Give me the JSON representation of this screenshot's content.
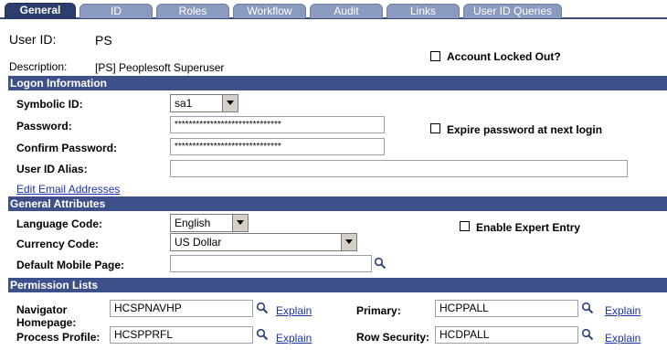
{
  "tabs": [
    "General",
    "ID",
    "Roles",
    "Workflow",
    "Audit",
    "Links",
    "User ID Queries"
  ],
  "header": {
    "user_id_label": "User ID:",
    "user_id_value": "PS",
    "description_label": "Description:",
    "description_value": "[PS] Peoplesoft Superuser",
    "account_locked_label": "Account Locked Out?"
  },
  "logon": {
    "section_title": "Logon Information",
    "symbolic_id_label": "Symbolic ID:",
    "symbolic_id_value": "sa1",
    "password_label": "Password:",
    "password_value": "******************************",
    "confirm_password_label": "Confirm Password:",
    "confirm_password_value": "******************************",
    "expire_label": "Expire password at next login",
    "alias_label": "User ID Alias:",
    "alias_value": "",
    "edit_email_link": "Edit Email Addresses"
  },
  "general": {
    "section_title": "General Attributes",
    "language_label": "Language Code:",
    "language_value": "English",
    "currency_label": "Currency Code:",
    "currency_value": "US Dollar",
    "mobile_label": "Default Mobile Page:",
    "mobile_value": "",
    "expert_label": "Enable Expert Entry"
  },
  "permissions": {
    "section_title": "Permission Lists",
    "navigator_label_1": "Navigator",
    "navigator_label_2": "Homepage:",
    "navigator_value": "HCSPNAVHP",
    "process_label": "Process Profile:",
    "process_value": "HCSPPRFL",
    "primary_label": "Primary:",
    "primary_value": "HCPPALL",
    "row_security_label": "Row Security:",
    "row_security_value": "HCDPALL",
    "explain_label": "Explain"
  },
  "icons": {
    "lookup": "magnifier-icon",
    "dropdown": "chevron-down-icon",
    "checkbox": "checkbox-icon"
  }
}
